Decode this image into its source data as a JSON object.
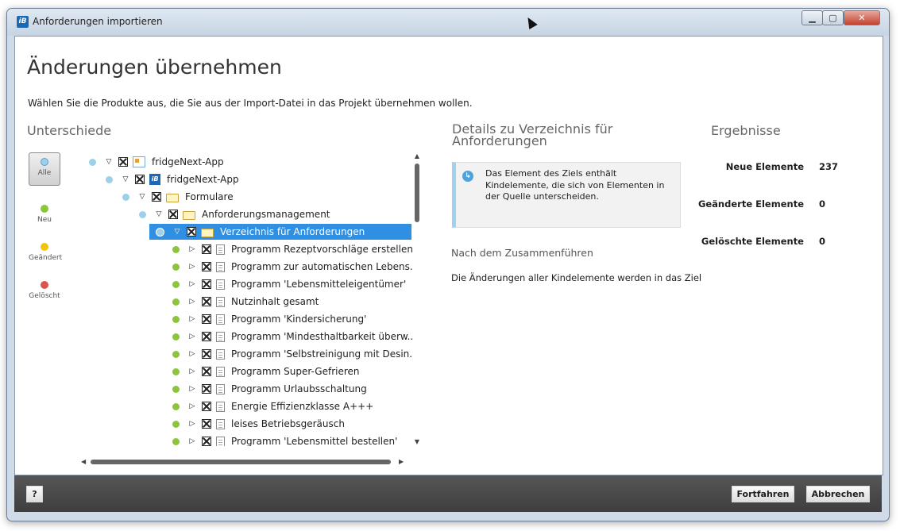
{
  "window": {
    "title": "Anforderungen importieren",
    "icon_text": "iB",
    "minimize_glyph": "▁",
    "maximize_glyph": "▢",
    "close_glyph": "✕"
  },
  "page": {
    "heading": "Änderungen übernehmen",
    "intro": "Wählen Sie die Produkte aus, die Sie aus der Import-Datei in das Projekt übernehmen wollen."
  },
  "differences": {
    "title": "Unterschiede",
    "filters": [
      {
        "label": "Alle",
        "color": "#9ccfea"
      },
      {
        "label": "Neu",
        "color": "#8cc43c"
      },
      {
        "label": "Geändert",
        "color": "#f1c40f"
      },
      {
        "label": "Gelöscht",
        "color": "#d9534f"
      }
    ]
  },
  "tree": {
    "rows": [
      {
        "label": "fridgeNext-App",
        "level": 0,
        "status": "blue",
        "expander": "▽",
        "icon": "app"
      },
      {
        "label": "fridgeNext-App",
        "level": 1,
        "status": "blue",
        "expander": "▽",
        "icon": "ib"
      },
      {
        "label": "Formulare",
        "level": 2,
        "status": "blue",
        "expander": "▽",
        "icon": "folder"
      },
      {
        "label": "Anforderungsmanagement",
        "level": 3,
        "status": "blue",
        "expander": "▽",
        "icon": "folder"
      },
      {
        "label": "Verzeichnis für Anforderungen",
        "level": 4,
        "status": "selected",
        "expander": "▽",
        "icon": "folder",
        "selected": true
      },
      {
        "label": "Programm Rezeptvorschläge erstellen",
        "level": 5,
        "status": "green",
        "expander": "▷",
        "icon": "doc"
      },
      {
        "label": "Programm zur automatischen Lebens...",
        "level": 5,
        "status": "green",
        "expander": "▷",
        "icon": "doc"
      },
      {
        "label": "Programm 'Lebensmitteleigentümer'",
        "level": 5,
        "status": "green",
        "expander": "▷",
        "icon": "doc"
      },
      {
        "label": "Nutzinhalt gesamt",
        "level": 5,
        "status": "green",
        "expander": "▷",
        "icon": "doc"
      },
      {
        "label": "Programm 'Kindersicherung'",
        "level": 5,
        "status": "green",
        "expander": "▷",
        "icon": "doc"
      },
      {
        "label": "Programm 'Mindesthaltbarkeit überw...",
        "level": 5,
        "status": "green",
        "expander": "▷",
        "icon": "doc"
      },
      {
        "label": "Programm 'Selbstreinigung mit Desin...",
        "level": 5,
        "status": "green",
        "expander": "▷",
        "icon": "doc"
      },
      {
        "label": "Programm Super-Gefrieren",
        "level": 5,
        "status": "green",
        "expander": "▷",
        "icon": "doc"
      },
      {
        "label": "Programm Urlaubsschaltung",
        "level": 5,
        "status": "green",
        "expander": "▷",
        "icon": "doc"
      },
      {
        "label": "Energie Effizienzklasse A+++",
        "level": 5,
        "status": "green",
        "expander": "▷",
        "icon": "doc"
      },
      {
        "label": "leises Betriebsgeräusch",
        "level": 5,
        "status": "green",
        "expander": "▷",
        "icon": "doc"
      },
      {
        "label": "Programm 'Lebensmittel bestellen'",
        "level": 5,
        "status": "green",
        "expander": "▷",
        "icon": "doc"
      }
    ]
  },
  "details": {
    "title": "Details zu Verzeichnis für Anforderungen",
    "info_text": "Das Element des Ziels enthält Kindelemente, die sich von Elementen in der Quelle unterscheiden.",
    "merge_title": "Nach dem Zusammenführen",
    "merge_text": "Die Änderungen aller Kindelemente werden in das Ziel"
  },
  "results": {
    "title": "Ergebnisse",
    "items": [
      {
        "label": "Neue Elemente",
        "value": "237"
      },
      {
        "label": "Geänderte Elemente",
        "value": "0"
      },
      {
        "label": "Gelöschte Elemente",
        "value": "0"
      }
    ]
  },
  "footer": {
    "help_label": "?",
    "continue_label": "Fortfahren",
    "cancel_label": "Abbrechen"
  }
}
